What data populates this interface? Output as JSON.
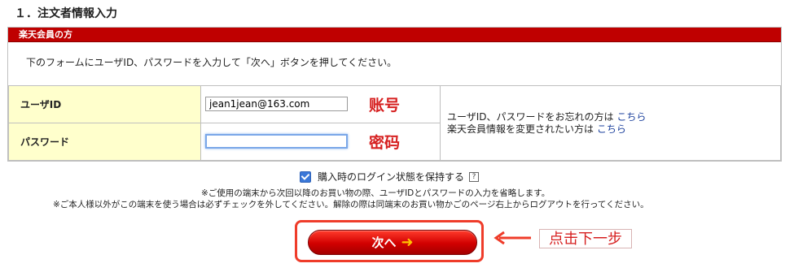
{
  "section_title": "１．注文者情報入力",
  "panel": {
    "header": "楽天会員の方",
    "instruction": "下のフォームにユーザID、パスワードを入力して「次へ」ボタンを押してください。"
  },
  "form": {
    "user_id_label": "ユーザID",
    "user_id_value": "jean1jean@163.com",
    "password_label": "パスワード",
    "password_value": "",
    "annotation_user": "账号",
    "annotation_password": "密码",
    "help_line1_text": "ユーザID、パスワードをお忘れの方は",
    "help_line1_link": "こちら",
    "help_line2_text": "楽天会員情報を変更されたい方は",
    "help_line2_link": "こちら"
  },
  "remember": {
    "label": "購入時のログイン状態を保持する",
    "checked": true,
    "help_icon": "?"
  },
  "notes": {
    "line1": "※ご使用の端末から次回以降のお買い物の際、ユーザIDとパスワードの入力を省略します。",
    "line2": "※ご本人様以外がこの端末を使う場合は必ずチェックを外してください。解除の際は同端末のお買い物かごのページ右上からログアウトを行ってください。"
  },
  "button": {
    "label": "次へ",
    "arrow_icon": "➜"
  },
  "callout": "点击下一步",
  "colors": {
    "header_red": "#bf0000",
    "annotation_red": "#d62020",
    "label_bg": "#ffffcc",
    "link_blue": "#1a3f9c"
  }
}
